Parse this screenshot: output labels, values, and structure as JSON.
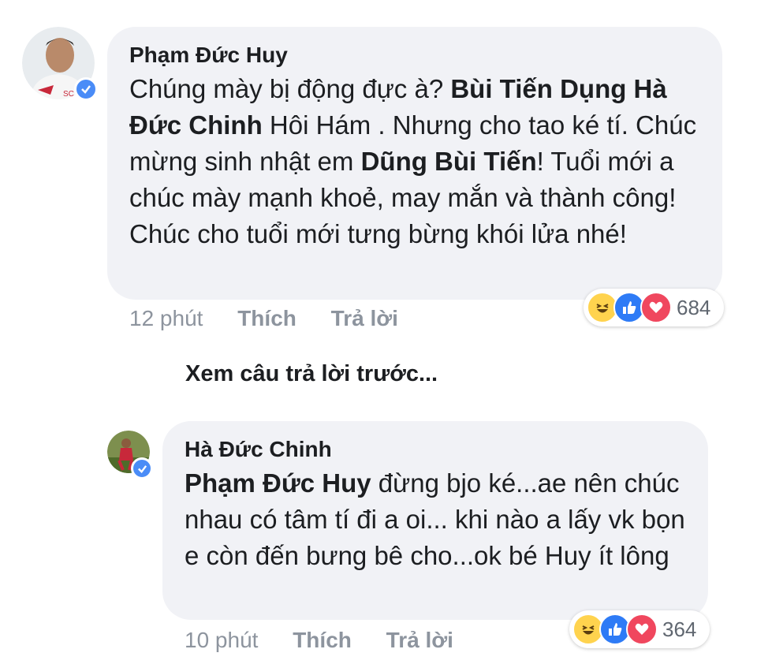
{
  "comments": [
    {
      "author": "Phạm Đức Huy",
      "text_segments": [
        {
          "text": "Chúng mày bị động đực à? ",
          "bold": false
        },
        {
          "text": "Bùi Tiến Dụng Hà Đức Chinh",
          "bold": true
        },
        {
          "text": " Hôi Hám . Nhưng cho tao ké tí. Chúc mừng sinh nhật em ",
          "bold": false
        },
        {
          "text": "Dũng Bùi Tiến",
          "bold": true
        },
        {
          "text": "! Tuổi mới a chúc mày mạnh khoẻ, may mắn và thành công! Chúc cho tuổi mới tưng bừng khói lửa nhé!",
          "bold": false
        }
      ],
      "time": "12 phút",
      "like_label": "Thích",
      "reply_label": "Trả lời",
      "reaction_count": "684",
      "reactions": [
        "haha-icon",
        "like-icon",
        "love-icon"
      ]
    },
    {
      "author": "Hà Đức Chinh",
      "text_segments": [
        {
          "text": "Phạm Đức Huy",
          "bold": true
        },
        {
          "text": " đừng bjo ké...ae nên chúc nhau có tâm tí đi a oi... khi nào a lấy vk bọn e còn đến bưng bê cho...ok bé Huy ít lông",
          "bold": false
        }
      ],
      "time": "10 phút",
      "like_label": "Thích",
      "reply_label": "Trả lời",
      "reaction_count": "364",
      "reactions": [
        "haha-icon",
        "like-icon",
        "love-icon"
      ]
    }
  ],
  "see_previous_replies": "Xem câu trả lời trước...",
  "colors": {
    "bubble": "#f1f2f6",
    "meta": "#8d949e",
    "verified": "#4a8cf7",
    "like": "#2e7bf6",
    "love": "#f0475e",
    "haha": "#ffd34e"
  }
}
